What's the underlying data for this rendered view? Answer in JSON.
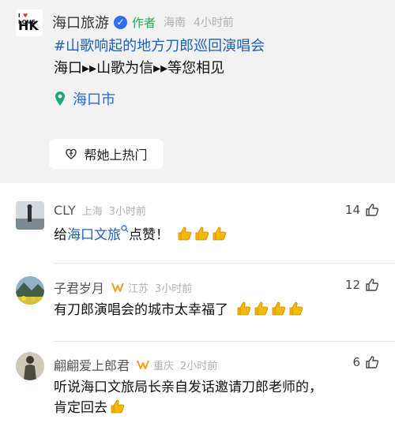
{
  "post": {
    "author": "海口旅游",
    "author_tag": "作者",
    "region": "海南",
    "time": "4小时前",
    "avatar_text_top": "I ♥ LOVE",
    "avatar_text_city": "HK",
    "hashtag_title": "#山歌响起的地方刀郎巡回演唱会",
    "subtitle": "海口▸▸山歌为信▸▸等您相见",
    "location": "海口市",
    "hot_button": "帮她上热门"
  },
  "comments": [
    {
      "name": "CLY",
      "region": "上海",
      "time": "3小时前",
      "likes": "14",
      "text_pre": "给",
      "text_link": "海口文旅",
      "text_post": "点赞！",
      "thumbs": 3
    },
    {
      "name": "子君岁月",
      "region": "江苏",
      "time": "3小时前",
      "likes": "12",
      "text": "有刀郎演唱会的城市太幸福了",
      "thumbs": 4
    },
    {
      "name": "翩翩爱上郎君",
      "region": "重庆",
      "time": "2小时前",
      "likes": "6",
      "text_line1": "听说海口文旅局长亲自发话邀请刀郎老师的，",
      "text_line2": "肯定回去",
      "thumbs": 1
    }
  ],
  "colors": {
    "link": "#1c5fbf",
    "verified": "#2f6cff",
    "author_tag": "#2aa94a",
    "thumb_yellow": "#f5b800"
  }
}
